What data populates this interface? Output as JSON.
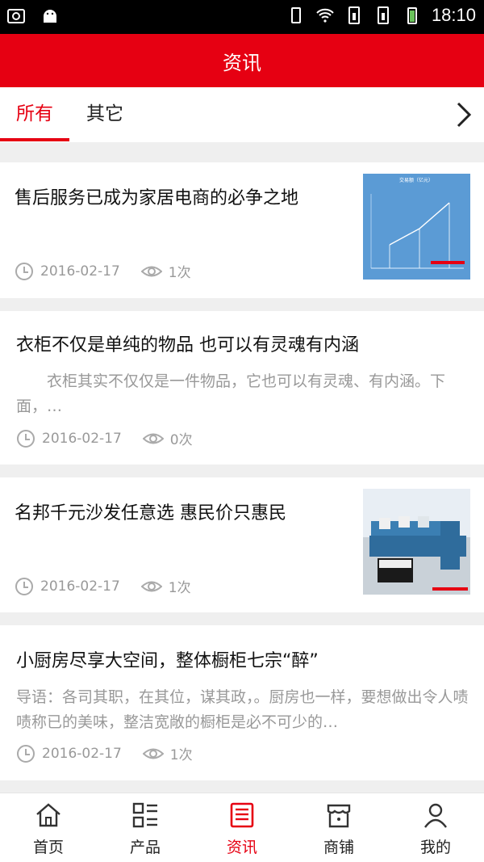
{
  "status_bar": {
    "time": "18:10"
  },
  "header": {
    "title": "资讯"
  },
  "tabs": [
    {
      "label": "所有",
      "active": true
    },
    {
      "label": "其它",
      "active": false
    }
  ],
  "articles": [
    {
      "title": "售后服务已成为家居电商的必争之地",
      "date": "2016-02-17",
      "views": "1次",
      "thumb_chart": {
        "title": "交易额（亿元）"
      }
    },
    {
      "title": "衣柜不仅是单纯的物品 也可以有灵魂有内涵",
      "desc": "　　衣柜其实不仅仅是一件物品，它也可以有灵魂、有内涵。下面，…",
      "date": "2016-02-17",
      "views": "0次"
    },
    {
      "title": "名邦千元沙发任意选 惠民价只惠民",
      "date": "2016-02-17",
      "views": "1次"
    },
    {
      "title": "小厨房尽享大空间，整体橱柜七宗“醉”",
      "desc": "导语：各司其职，在其位，谋其政，。厨房也一样，要想做出令人啧啧称已的美味，整洁宽敞的橱柜是必不可少的…",
      "date": "2016-02-17",
      "views": "1次"
    }
  ],
  "bottom_nav": [
    {
      "label": "首页",
      "icon": "home-icon",
      "active": false
    },
    {
      "label": "产品",
      "icon": "grid-list-icon",
      "active": false
    },
    {
      "label": "资讯",
      "icon": "news-icon",
      "active": true
    },
    {
      "label": "商铺",
      "icon": "shop-icon",
      "active": false
    },
    {
      "label": "我的",
      "icon": "user-icon",
      "active": false
    }
  ],
  "colors": {
    "accent": "#e60012",
    "background": "#efefef",
    "muted_text": "#999999"
  }
}
